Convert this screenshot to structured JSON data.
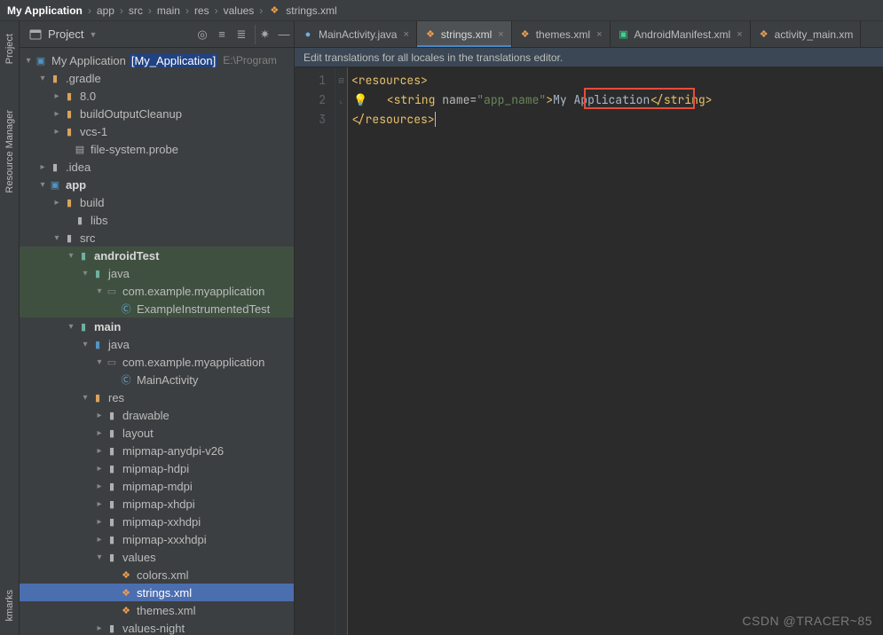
{
  "breadcrumb": {
    "root": "My Application",
    "parts": [
      "app",
      "src",
      "main",
      "res",
      "values",
      "strings.xml"
    ]
  },
  "project_tool": {
    "label": "Project"
  },
  "side_tools": {
    "project": "Project",
    "resource_manager": "Resource Manager",
    "bookmarks": "kmarks"
  },
  "tabs": [
    {
      "label": "MainActivity.java",
      "kind": "java",
      "active": false
    },
    {
      "label": "strings.xml",
      "kind": "xml",
      "active": true
    },
    {
      "label": "themes.xml",
      "kind": "xml",
      "active": false
    },
    {
      "label": "AndroidManifest.xml",
      "kind": "man",
      "active": false
    },
    {
      "label": "activity_main.xm",
      "kind": "xml",
      "active": false
    }
  ],
  "banner": "Edit translations for all locales in the translations editor.",
  "tree_root": {
    "name": "My Application",
    "tag": "[My_Application]",
    "path_hint": "E:\\Program"
  },
  "tree": {
    "gradle": ".gradle",
    "v80": "8.0",
    "buildOutputCleanup": "buildOutputCleanup",
    "vcs1": "vcs-1",
    "fsprobe": "file-system.probe",
    "idea": ".idea",
    "app": "app",
    "build": "build",
    "libs": "libs",
    "src": "src",
    "androidTest": "androidTest",
    "java_at": "java",
    "pkg_at": "com.example.myapplication",
    "eit": "ExampleInstrumentedTest",
    "main": "main",
    "java_main": "java",
    "pkg_main": "com.example.myapplication",
    "mainact": "MainActivity",
    "res": "res",
    "drawable": "drawable",
    "layout": "layout",
    "mm_any": "mipmap-anydpi-v26",
    "mm_h": "mipmap-hdpi",
    "mm_m": "mipmap-mdpi",
    "mm_xh": "mipmap-xhdpi",
    "mm_xxh": "mipmap-xxhdpi",
    "mm_xxxh": "mipmap-xxxhdpi",
    "values": "values",
    "colorsxml": "colors.xml",
    "stringsxml": "strings.xml",
    "themesxml": "themes.xml",
    "valuesnight": "values-night"
  },
  "code": {
    "line1_open": "<resources>",
    "line2_open": "<string",
    "line2_attr_name": "name",
    "line2_attr_val": "\"app_name\"",
    "line2_text": "My Application",
    "line2_close": "</string>",
    "line3": "</resources>",
    "line_numbers": [
      "1",
      "2",
      "3"
    ]
  },
  "watermark": "CSDN @TRACER~85"
}
